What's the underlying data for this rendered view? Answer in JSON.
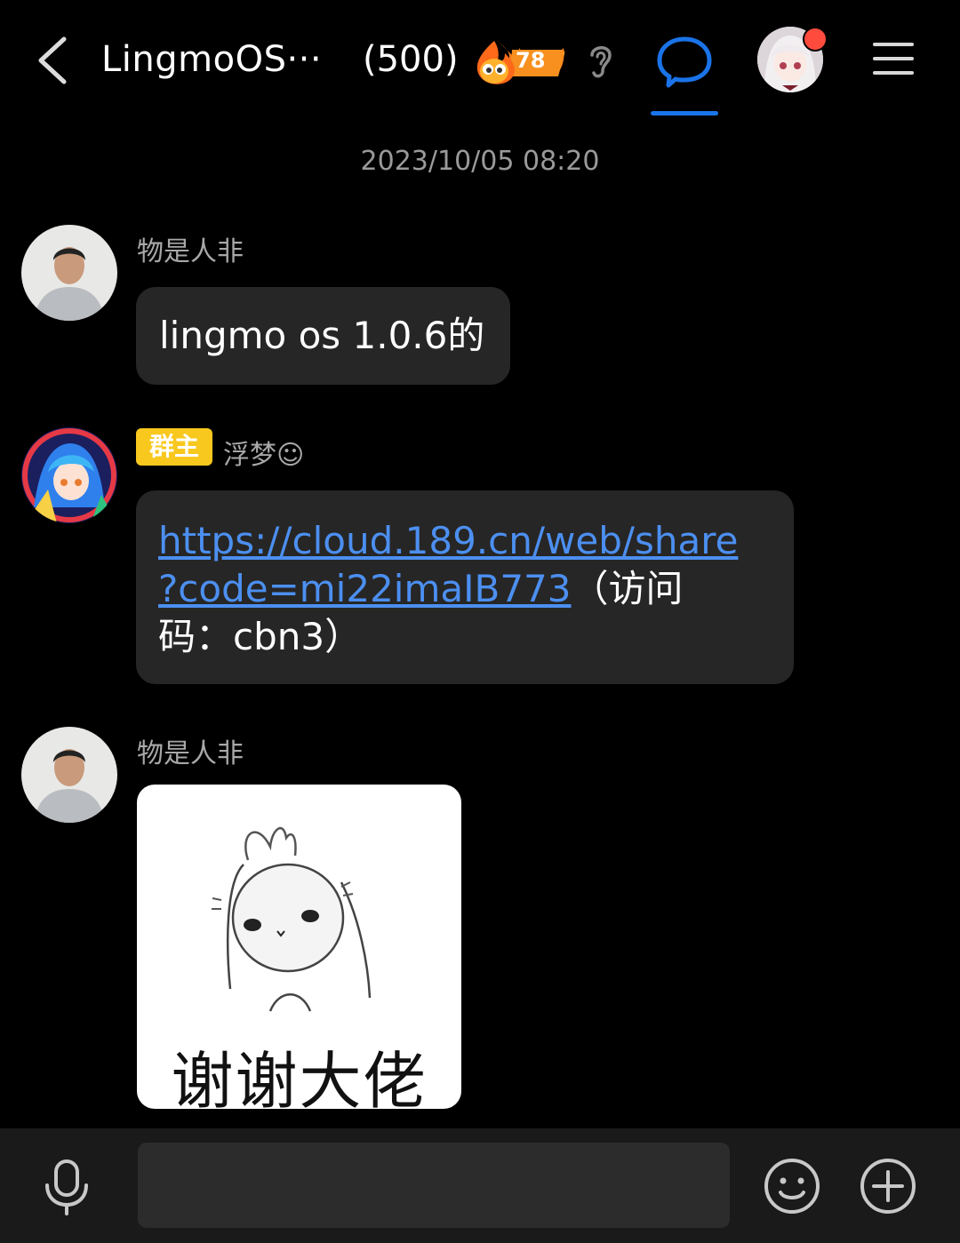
{
  "header": {
    "title": "LingmoOS···",
    "member_count": "(500)",
    "fire_level": "78"
  },
  "chat": {
    "timestamp": "2023/10/05 08:20",
    "messages": [
      {
        "sender": "物是人非",
        "text": "lingmo os 1.0.6的"
      },
      {
        "badge": "群主",
        "sender": "浮梦☺",
        "link_line1": "https://cloud.189.cn/web/share",
        "link_line2": "?code=mi22imaIB773",
        "text_tail": "（访问",
        "text_line3": "码：cbn3）"
      },
      {
        "sender": "物是人非",
        "sticker_caption": "谢谢大佬"
      }
    ]
  },
  "colors": {
    "background": "#000000",
    "bubble": "#262626",
    "link": "#4c8ff0",
    "accent": "#1a73e8",
    "owner_badge": "#f8c81e"
  }
}
